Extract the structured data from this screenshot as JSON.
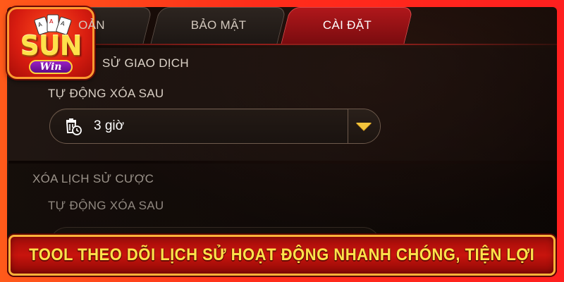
{
  "logo": {
    "text": "SUN",
    "subtext": "Win"
  },
  "tabs": [
    {
      "label": "OẢN",
      "active": false
    },
    {
      "label": "BẢO MẬT",
      "active": false
    },
    {
      "label": "CÀI ĐẶT",
      "active": true
    }
  ],
  "section_transactions": {
    "title": "SỬ GIAO DỊCH",
    "auto_delete_label": "TỰ ĐỘNG XÓA SAU",
    "dropdown": {
      "icon": "trash-clock-icon",
      "value": "3 giờ"
    }
  },
  "section_bets": {
    "title": "XÓA LỊCH SỬ CƯỢC",
    "auto_delete_label": "TỰ ĐỘNG XÓA SAU"
  },
  "banner": {
    "text": "TOOL THEO DÕI LỊCH SỬ HOẠT ĐỘNG NHANH CHÓNG, TIỆN LỢI"
  },
  "colors": {
    "frame": "#ff3a1a",
    "active_tab": "#a01418",
    "chevron": "#f3c43c",
    "banner_text": "#ffe24a"
  }
}
